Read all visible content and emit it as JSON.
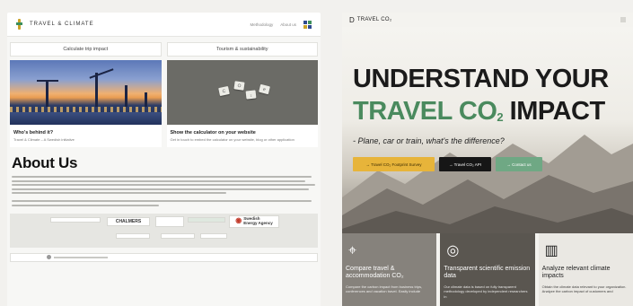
{
  "left": {
    "brand": "TRAVEL & CLIMATE",
    "nav": [
      "Methodology",
      "About us"
    ],
    "tabs": [
      "Calculate trip impact",
      "Tourism & sustainability"
    ],
    "cards": [
      {
        "title": "Who's behind it?",
        "sub": "Travel & Climate – A Swedish initiative"
      },
      {
        "title": "Show the calculator on your website",
        "sub": "Get in touch to embed the calculator on your website, blog or other application"
      }
    ],
    "tile_letters": [
      "C",
      "O",
      "₂",
      "e"
    ],
    "about": {
      "heading": "About Us"
    },
    "partners": {
      "chalmers": "CHALMERS",
      "swedish_energy": "Swedish\nEnergy Agency"
    }
  },
  "right": {
    "brand": "TRAVEL CO₂",
    "logo_mark": "D",
    "headline_1": "UNDERSTAND YOUR",
    "headline_2_green": "TRAVEL CO",
    "headline_2_sub": "2",
    "headline_2_dark": " IMPACT",
    "tagline": "- Plane, car or train, what's the difference?",
    "buttons": [
      "→ Travel CO₂ Footprint Survey",
      "→ Travel CO₂ API",
      "→ Contact us"
    ],
    "features": [
      {
        "icon": "map-pin-icon",
        "glyph": "⌖",
        "title": "Compare travel & accommodation CO₂",
        "desc": "Compare the carbon impact from business trips, conferences and vacation travel. Easily include"
      },
      {
        "icon": "target-icon",
        "glyph": "◎",
        "title": "Transparent scientific emission data",
        "desc": "Our climate data is based on fully transparent methodology developed by independent researchers in"
      },
      {
        "icon": "bar-chart-icon",
        "glyph": "▥",
        "title": "Analyze relevant climate impacts",
        "desc": "Obtain the climate data relevant to your organization. Analyze the carbon impact of customers and"
      }
    ]
  }
}
